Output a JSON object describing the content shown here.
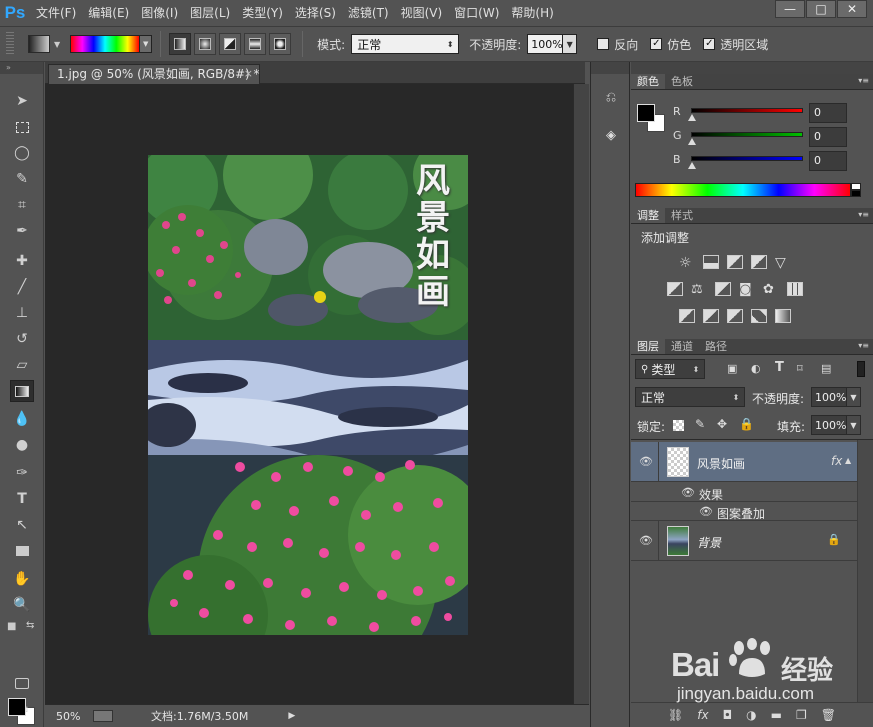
{
  "app": {
    "logo": "Ps",
    "menu": [
      "文件(F)",
      "编辑(E)",
      "图像(I)",
      "图层(L)",
      "类型(Y)",
      "选择(S)",
      "滤镜(T)",
      "视图(V)",
      "窗口(W)",
      "帮助(H)"
    ],
    "window_controls": [
      "—",
      "□",
      "✕"
    ]
  },
  "options": {
    "mode_label": "模式:",
    "mode_value": "正常",
    "opacity_label": "不透明度:",
    "opacity_value": "100%",
    "reverse_label": "反向",
    "dither_label": "仿色",
    "transparency_label": "透明区域",
    "reverse_checked": false,
    "dither_checked": true,
    "transparency_checked": true
  },
  "document": {
    "tab_title": "1.jpg @ 50% (风景如画, RGB/8#) *",
    "close": "×",
    "image_text": "风景如画",
    "zoom": "50%",
    "doc_info": "文档:1.76M/3.50M"
  },
  "color_panel": {
    "tabs": [
      "颜色",
      "色板"
    ],
    "channels": [
      {
        "label": "R",
        "value": "0",
        "color": "#ff0000"
      },
      {
        "label": "G",
        "value": "0",
        "color": "#00c000"
      },
      {
        "label": "B",
        "value": "0",
        "color": "#0000ff"
      }
    ],
    "foreground": "#000000",
    "background": "#ffffff"
  },
  "adjust_panel": {
    "tabs": [
      "调整",
      "样式"
    ],
    "title": "添加调整"
  },
  "layers_panel": {
    "tabs": [
      "图层",
      "通道",
      "路径"
    ],
    "filter_label": "类型",
    "blend_mode": "正常",
    "opacity_label": "不透明度:",
    "opacity_value": "100%",
    "lock_label": "锁定:",
    "fill_label": "填充:",
    "fill_value": "100%",
    "layers": [
      {
        "name": "风景如画",
        "fx": "fx",
        "selected": true
      },
      {
        "name": "背景",
        "locked": true
      }
    ],
    "effects_label": "效果",
    "effect_item": "图案叠加"
  },
  "watermark": {
    "brand": "Bai",
    "brand_cn": "经验",
    "url": "jingyan.baidu.com"
  }
}
